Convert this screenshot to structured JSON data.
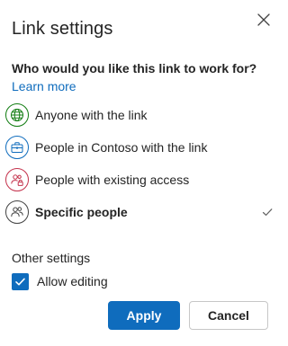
{
  "dialog": {
    "title": "Link settings"
  },
  "question": {
    "text": "Who would you like this link to work for?",
    "learn_more": "Learn more"
  },
  "options": [
    {
      "label": "Anyone with the link",
      "icon": "globe-icon",
      "color": "#107c10",
      "selected": false
    },
    {
      "label": "People in Contoso with the link",
      "icon": "briefcase-icon",
      "color": "#0f6cbd",
      "selected": false
    },
    {
      "label": "People with existing access",
      "icon": "people-lock-icon",
      "color": "#c4314b",
      "selected": false
    },
    {
      "label": "Specific people",
      "icon": "people-icon",
      "color": "#424242",
      "selected": true
    }
  ],
  "other_settings": {
    "heading": "Other settings",
    "allow_editing_label": "Allow editing",
    "allow_editing_checked": true
  },
  "buttons": {
    "apply": "Apply",
    "cancel": "Cancel"
  },
  "colors": {
    "accent": "#0f6cbd",
    "text": "#242424"
  }
}
